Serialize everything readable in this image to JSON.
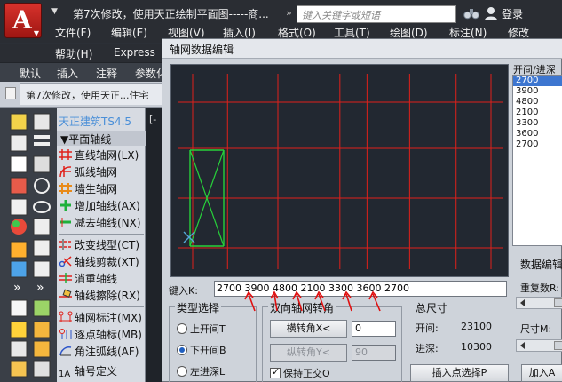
{
  "titlebar": {
    "title": "第7次修改，使用天正绘制平面图-----商...",
    "search_placeholder": "键入关键字或短语",
    "login": "登录"
  },
  "menu": {
    "row1": [
      "文件(F)",
      "编辑(E)",
      "视图(V)",
      "插入(I)",
      "格式(O)",
      "工具(T)",
      "绘图(D)",
      "标注(N)",
      "修改"
    ],
    "row2": [
      "帮助(H)",
      "Express"
    ]
  },
  "ribbon_tabs": [
    "默认",
    "插入",
    "注释",
    "参数化"
  ],
  "doc_tab": {
    "label": "第7次修改，使用天正...住宅"
  },
  "palette": {
    "title": "天正建筑TS4.5",
    "section": "▼平面轴线",
    "items": [
      "直线轴网(LX)",
      "弧线轴网",
      "墙生轴网",
      "增加轴线(AX)",
      "减去轴线(NX)",
      "改变线型(CT)",
      "轴线剪裁(XT)",
      "消重轴线",
      "轴线擦除(RX)",
      "轴网标注(MX)",
      "逐点轴标(MB)",
      "角注弧线(AF)",
      "轴号定义"
    ]
  },
  "dialog": {
    "title": "轴网数据编辑",
    "list_label": "开间/进深",
    "list_items": [
      "2700",
      "3900",
      "4800",
      "2100",
      "3300",
      "3600",
      "2700"
    ],
    "selected_index": 0,
    "side": {
      "edit_label": "数据编辑",
      "repeat_label": "重复数R:",
      "size_label": "尺寸M:",
      "add_button": "加入A"
    },
    "key_label": "键入K:",
    "key_value": "2700  3900  4800  2100  3300  3600  2700",
    "type_group": {
      "title": "类型选择",
      "options": [
        "上开间T",
        "下开间B",
        "左进深L"
      ],
      "selected": 1
    },
    "rotate_group": {
      "title": "双向轴网转角",
      "h_button": "横转角X<",
      "h_value": "0",
      "v_button": "纵转角Y<",
      "v_value": "90",
      "keep_ortho": "保持正交O",
      "keep_ortho_checked": true
    },
    "summary": {
      "title": "总尺寸",
      "bay_label": "开间:",
      "bay_value": "23100",
      "depth_label": "进深:",
      "depth_value": "10300"
    },
    "insert_button": "插入点选择P"
  },
  "cad_strip": {
    "label": "[-"
  },
  "colors": {
    "grid_line": "#e0201a",
    "element": "#27d13a",
    "ucs": "#55a9d6",
    "annotation": "#e01010",
    "selection": "#3d76d0"
  }
}
